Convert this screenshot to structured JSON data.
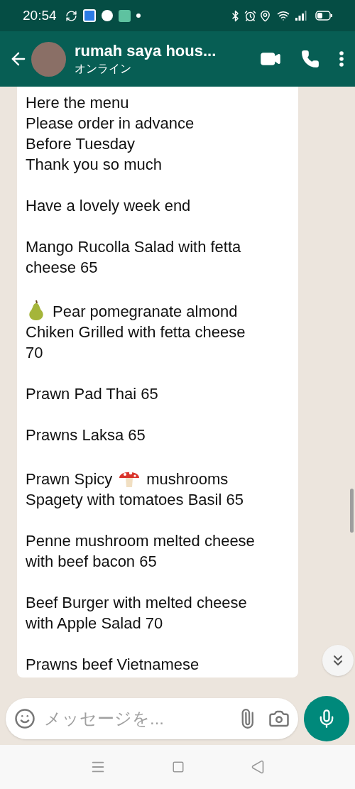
{
  "status_bar": {
    "time": "20:54"
  },
  "header": {
    "contact_name": "rumah saya hous...",
    "presence": "オンライン"
  },
  "message": {
    "paragraphs": [
      [
        [
          {
            "kind": "text",
            "text": "Here the menu"
          }
        ],
        [
          {
            "kind": "text",
            "text": "Please order in advance"
          }
        ],
        [
          {
            "kind": "text",
            "text": "Before Tuesday"
          }
        ],
        [
          {
            "kind": "text",
            "text": "Thank you so much"
          }
        ]
      ],
      [
        [
          {
            "kind": "text",
            "text": "Have a lovely week end"
          }
        ]
      ],
      [
        [
          {
            "kind": "text",
            "text": "Mango Rucolla Salad with fetta"
          }
        ],
        [
          {
            "kind": "text",
            "text": "cheese 65"
          }
        ]
      ],
      [
        [
          {
            "kind": "pear"
          },
          {
            "kind": "text",
            "text": "Pear pomegranate almond"
          }
        ],
        [
          {
            "kind": "text",
            "text": "Chiken Grilled with fetta cheese"
          }
        ],
        [
          {
            "kind": "text",
            "text": "70"
          }
        ]
      ],
      [
        [
          {
            "kind": "text",
            "text": "Prawn Pad Thai 65"
          }
        ]
      ],
      [
        [
          {
            "kind": "text",
            "text": "Prawns Laksa 65"
          }
        ]
      ],
      [
        [
          {
            "kind": "text",
            "text": "Prawn Spicy"
          },
          {
            "kind": "mushroom"
          },
          {
            "kind": "text",
            "text": "mushrooms"
          }
        ],
        [
          {
            "kind": "text",
            "text": "Spagety with tomatoes Basil 65"
          }
        ]
      ],
      [
        [
          {
            "kind": "text",
            "text": "Penne mushroom melted cheese"
          }
        ],
        [
          {
            "kind": "text",
            "text": "with beef bacon 65"
          }
        ]
      ],
      [
        [
          {
            "kind": "text",
            "text": "Beef Burger with melted cheese"
          }
        ],
        [
          {
            "kind": "text",
            "text": "with Apple Salad 70"
          }
        ]
      ],
      [
        [
          {
            "kind": "text",
            "text": "Prawns beef Vietnamese"
          }
        ]
      ]
    ]
  },
  "composer": {
    "placeholder": "メッセージを..."
  }
}
